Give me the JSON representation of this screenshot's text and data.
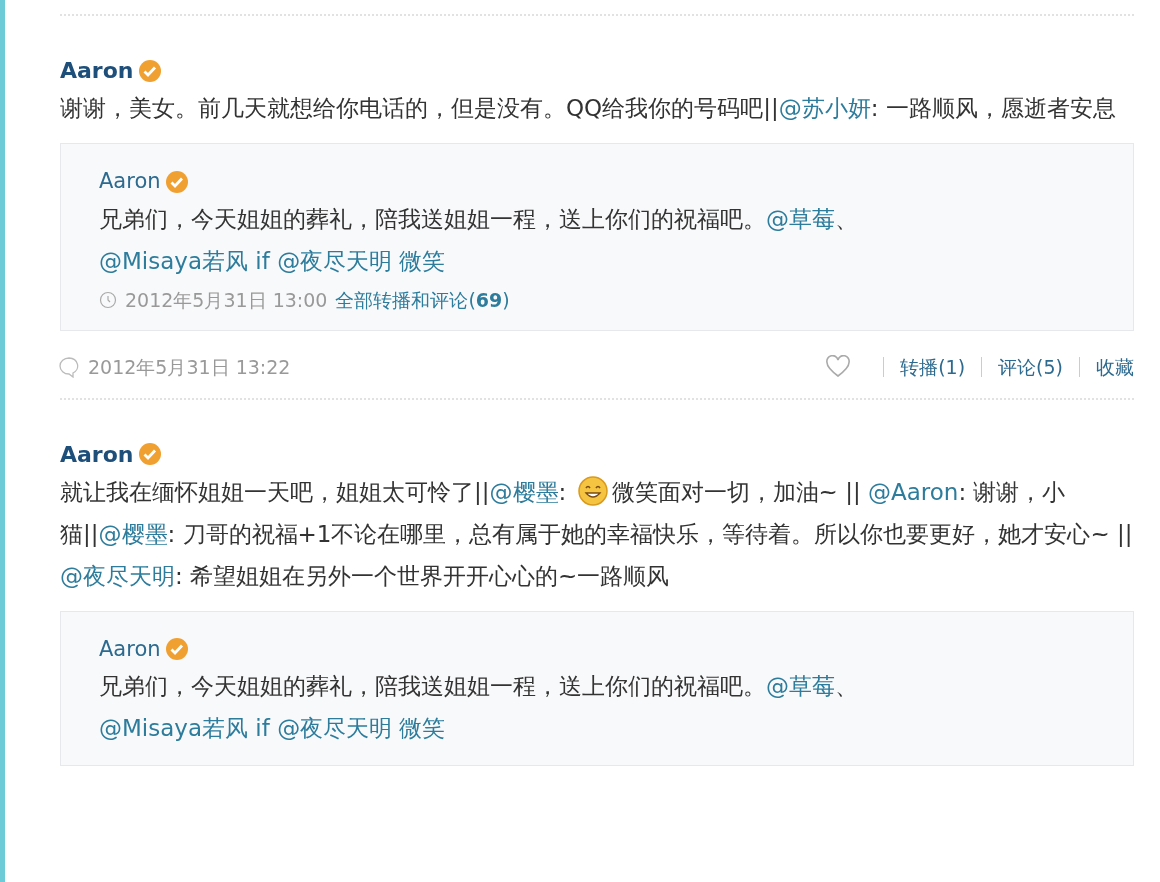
{
  "posts": [
    {
      "author": "Aaron",
      "verified": true,
      "text": [
        {
          "kind": "text",
          "text": "谢谢，美女。前几天就想给你电话的，但是没有。QQ给我你的号码吧||"
        },
        {
          "kind": "mention",
          "text": "@苏小妍"
        },
        {
          "kind": "text",
          "text": ": 一路顺风，愿逝者安息"
        }
      ],
      "repost": {
        "author": "Aaron",
        "verified": true,
        "text": [
          {
            "kind": "text",
            "text": "兄弟们，今天姐姐的葬礼，陪我送姐姐一程，送上你们的祝福吧。"
          },
          {
            "kind": "mention",
            "text": "@草莓"
          },
          {
            "kind": "text",
            "text": "、 "
          },
          {
            "kind": "mention",
            "text": "@Misaya若风"
          },
          {
            "kind": "mention",
            "text": " if "
          },
          {
            "kind": "mention",
            "text": "@夜尽天明"
          },
          {
            "kind": "mention",
            "text": " 微笑"
          }
        ],
        "time": "2012年5月31日 13:00",
        "link": "全部转播和评论(**69**)"
      },
      "time": "2012年5月31日 13:22",
      "liked": false,
      "actions": [
        "转播(1)",
        "评论(5)",
        "收藏"
      ]
    },
    {
      "author": "Aaron",
      "verified": true,
      "text": [
        {
          "kind": "text",
          "text": "就让我在缅怀姐姐一天吧，姐姐太可怜了||"
        },
        {
          "kind": "mention",
          "text": "@樱墨"
        },
        {
          "kind": "text",
          "text": ": "
        },
        {
          "kind": "emoji"
        },
        {
          "kind": "text",
          "text": "微笑面对一切，加油~ || "
        },
        {
          "kind": "mention",
          "text": "@Aaron"
        },
        {
          "kind": "text",
          "text": ": 谢谢，小猫||"
        },
        {
          "kind": "mention",
          "text": "@樱墨"
        },
        {
          "kind": "text",
          "text": ": 刀哥的祝福+1不论在哪里，总有属于她的幸福快乐，等待着。所以你也要更好，她才安心~ || "
        },
        {
          "kind": "mention",
          "text": "@夜尽天明"
        },
        {
          "kind": "text",
          "text": ": 希望姐姐在另外一个世界开开心心的~一路顺风"
        }
      ],
      "repost": {
        "author": "Aaron",
        "verified": true,
        "text": [
          {
            "kind": "text",
            "text": "兄弟们，今天姐姐的葬礼，陪我送姐姐一程，送上你们的祝福吧。"
          },
          {
            "kind": "mention",
            "text": "@草莓"
          },
          {
            "kind": "text",
            "text": "、 "
          },
          {
            "kind": "mention",
            "text": "@Misaya若风"
          },
          {
            "kind": "mention",
            "text": " if "
          },
          {
            "kind": "mention",
            "text": "@夜尽天明"
          },
          {
            "kind": "mention",
            "text": " 微笑"
          }
        ]
      }
    }
  ]
}
